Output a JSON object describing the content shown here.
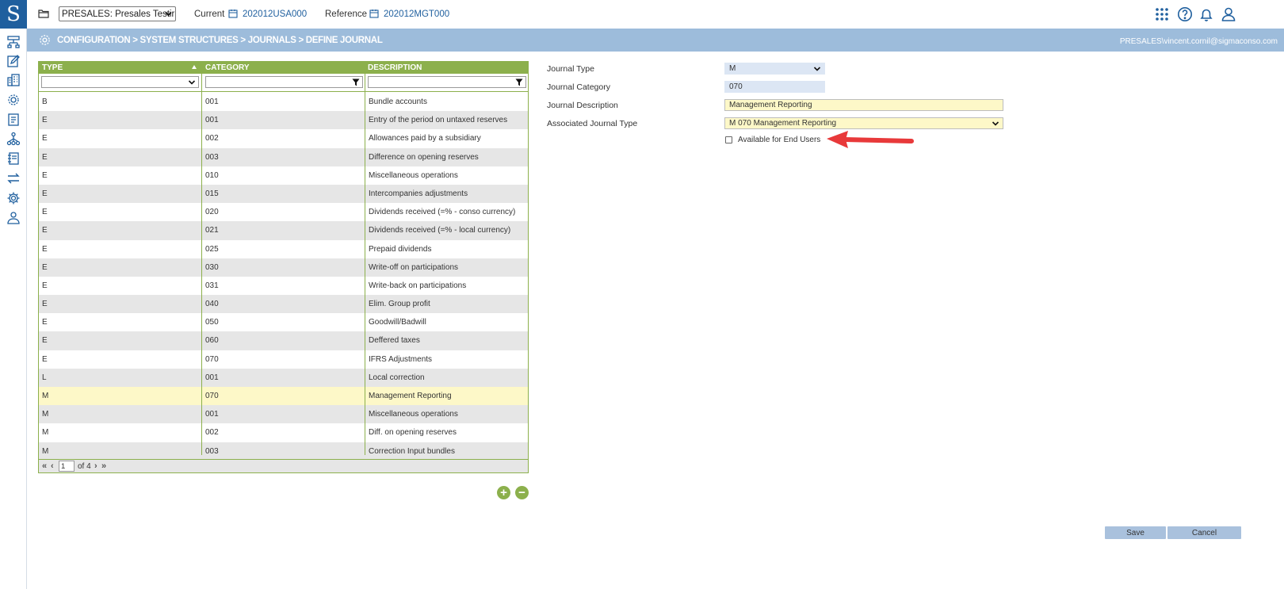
{
  "app": {
    "logo_letter": "S"
  },
  "topbar": {
    "context_value": "PRESALES: Presales Testir",
    "current_label": "Current",
    "current_value": "202012USA000",
    "reference_label": "Reference",
    "reference_value": "202012MGT000"
  },
  "banner": {
    "breadcrumb": "CONFIGURATION > SYSTEM STRUCTURES > JOURNALS > DEFINE JOURNAL",
    "user": "PRESALES\\vincent.cornil@sigmaconso.com"
  },
  "grid": {
    "columns": [
      "TYPE",
      "CATEGORY",
      "DESCRIPTION"
    ],
    "rows": [
      {
        "type": "B",
        "category": "001",
        "description": "Bundle accounts"
      },
      {
        "type": "E",
        "category": "001",
        "description": "Entry of the period on untaxed reserves"
      },
      {
        "type": "E",
        "category": "002",
        "description": "Allowances paid by a subsidiary"
      },
      {
        "type": "E",
        "category": "003",
        "description": "Difference on opening reserves"
      },
      {
        "type": "E",
        "category": "010",
        "description": "Miscellaneous operations"
      },
      {
        "type": "E",
        "category": "015",
        "description": "Intercompanies adjustments"
      },
      {
        "type": "E",
        "category": "020",
        "description": "Dividends received (=% - conso currency)"
      },
      {
        "type": "E",
        "category": "021",
        "description": "Dividends received (=% - local currency)"
      },
      {
        "type": "E",
        "category": "025",
        "description": "Prepaid dividends"
      },
      {
        "type": "E",
        "category": "030",
        "description": "Write-off on participations"
      },
      {
        "type": "E",
        "category": "031",
        "description": "Write-back on participations"
      },
      {
        "type": "E",
        "category": "040",
        "description": "Elim. Group profit"
      },
      {
        "type": "E",
        "category": "050",
        "description": "Goodwill/Badwill"
      },
      {
        "type": "E",
        "category": "060",
        "description": "Deffered taxes"
      },
      {
        "type": "E",
        "category": "070",
        "description": "IFRS Adjustments"
      },
      {
        "type": "L",
        "category": "001",
        "description": "Local correction"
      },
      {
        "type": "M",
        "category": "070",
        "description": "Management Reporting"
      },
      {
        "type": "M",
        "category": "001",
        "description": "Miscellaneous operations"
      },
      {
        "type": "M",
        "category": "002",
        "description": "Diff. on opening reserves"
      },
      {
        "type": "M",
        "category": "003",
        "description": "Correction Input bundles"
      }
    ],
    "selected_row": 16,
    "pager": {
      "current_page": "1",
      "of_label": "of",
      "total_pages": "4"
    }
  },
  "form": {
    "journal_type_label": "Journal Type",
    "journal_type_value": "M",
    "journal_category_label": "Journal Category",
    "journal_category_value": "070",
    "journal_description_label": "Journal Description",
    "journal_description_value": "Management Reporting",
    "associated_type_label": "Associated Journal Type",
    "associated_type_value": "M 070 Management Reporting",
    "end_users_label": "Available for End Users",
    "end_users_checked": false
  },
  "actions": {
    "save": "Save",
    "cancel": "Cancel"
  },
  "colors": {
    "brand_blue": "#1f5f9e",
    "banner": "#9dbcdb",
    "grid_green": "#8cb04c",
    "selected_row": "#fdf8c8",
    "annotation_arrow": "#e8393a"
  },
  "icons": {
    "rail": [
      "structure-icon",
      "edit-icon",
      "buildings-icon",
      "network-gear-icon",
      "report-icon",
      "hierarchy-icon",
      "journal-icon",
      "transfer-icon",
      "settings-icon",
      "users-icon"
    ],
    "top_right": [
      "apps-grid-icon",
      "help-icon",
      "bell-icon",
      "user-icon"
    ]
  }
}
